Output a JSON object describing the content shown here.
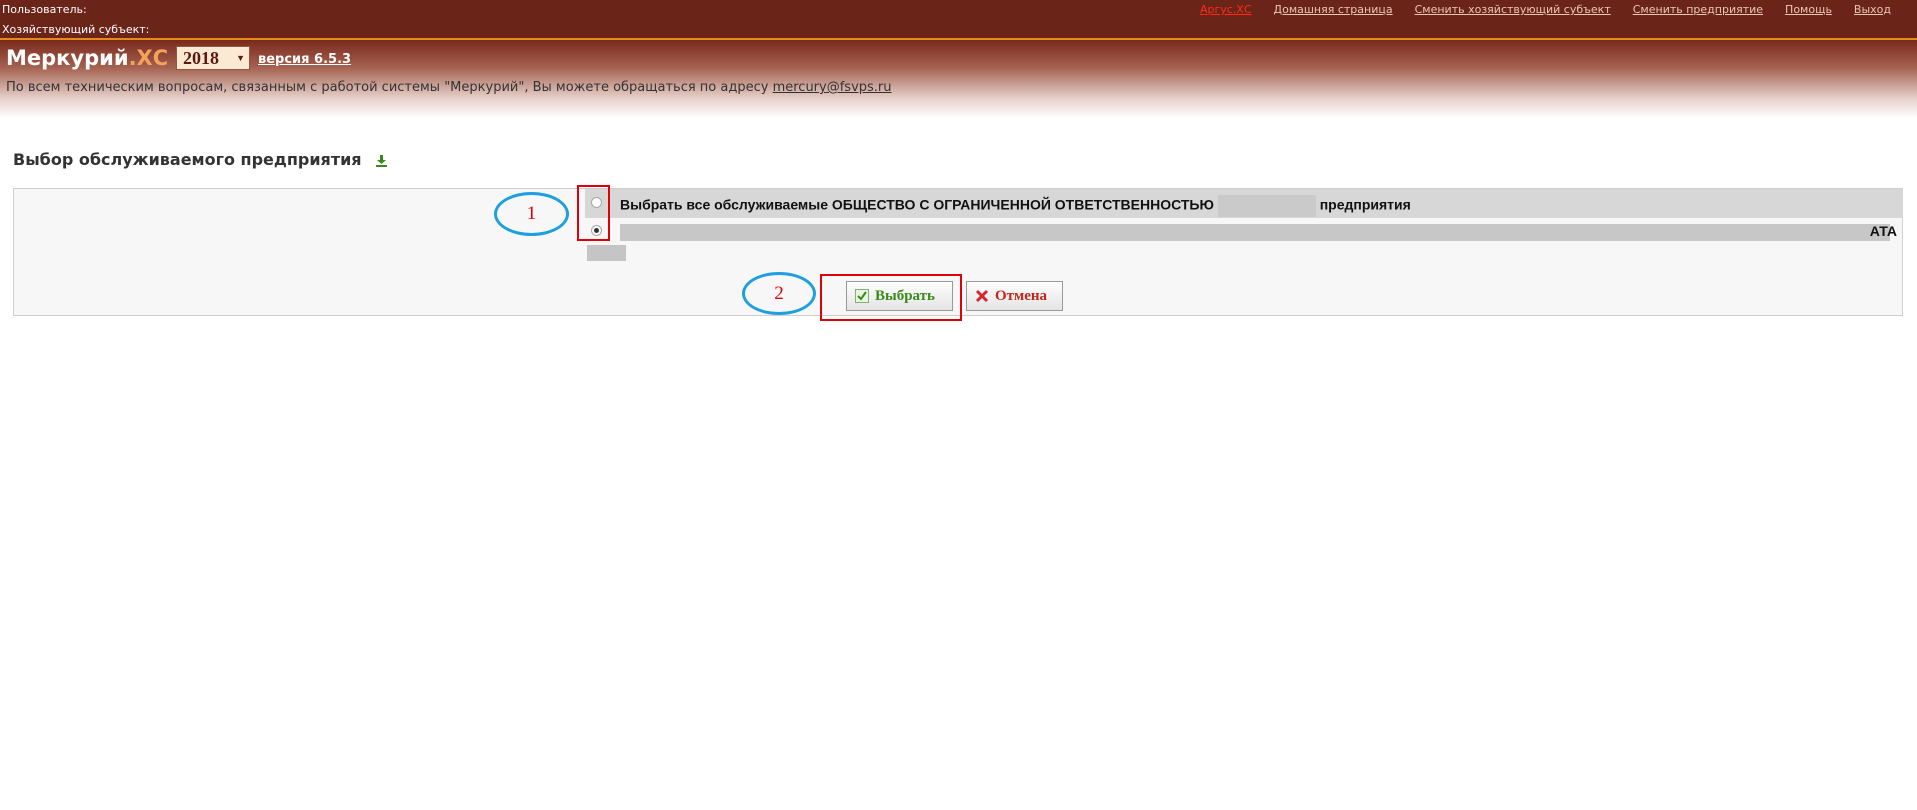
{
  "topbar": {
    "user_label": "Пользователь:",
    "subject_label": "Хозяйствующий субъект: ",
    "nav": [
      {
        "label": "Аргус.ХС",
        "active": true
      },
      {
        "label": "Домашняя страница",
        "active": false
      },
      {
        "label": "Сменить хозяйствующий субъект",
        "active": false
      },
      {
        "label": "Сменить предприятие",
        "active": false
      },
      {
        "label": "Помощь",
        "active": false
      },
      {
        "label": "Выход",
        "active": false
      }
    ]
  },
  "header": {
    "logo_main": "Меркурий",
    "logo_suffix": ".ХС",
    "year": "2018",
    "version": "версия 6.5.3",
    "support_text": "По всем техническим вопросам, связанным с работой системы \"Меркурий\", Вы можете обращаться по адресу ",
    "support_email": "mercury@fsvps.ru"
  },
  "page": {
    "title": "Выбор обслуживаемого предприятия"
  },
  "form": {
    "option_all_prefix": "Выбрать все обслуживаемые ОБЩЕСТВО С ОГРАНИЧЕННОЙ ОТВЕТСТВЕННОСТЬЮ",
    "option_all_suffix": "предприятия",
    "option_one_suffix": "АТА",
    "option_all_checked": false,
    "option_one_checked": true
  },
  "buttons": {
    "ok_label": "Выбрать",
    "cancel_label": "Отмена"
  },
  "annotations": {
    "marker_1": "1",
    "marker_2": "2",
    "highlight_color": "#e0000a",
    "ellipse_color": "#1d9fe0"
  },
  "colors": {
    "topbar_bg": "#6b2418",
    "accent_orange": "#e8891e",
    "ok_green": "#3a8a1a",
    "cancel_red": "#c0261a"
  }
}
